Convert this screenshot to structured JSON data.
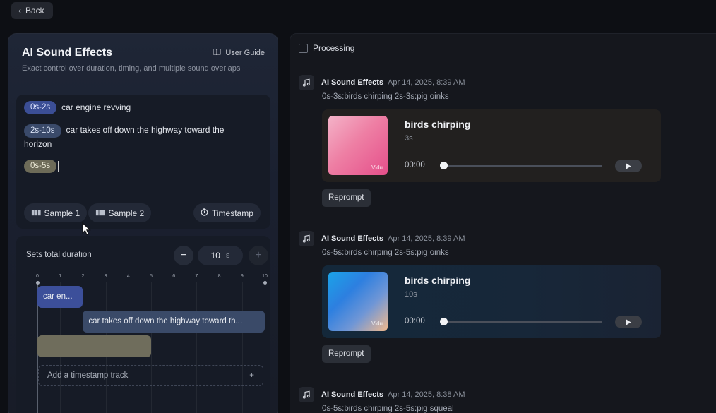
{
  "topbar": {
    "back_label": "Back"
  },
  "left": {
    "title": "AI Sound Effects",
    "guide_label": "User Guide",
    "description": "Exact control over duration, timing, and multiple sound overlaps",
    "segments": [
      {
        "range": "0s-2s",
        "text": "car engine revving"
      },
      {
        "range": "2s-10s",
        "text": "car takes off down the highway toward the horizon"
      },
      {
        "range": "0s-5s",
        "text": ""
      }
    ],
    "samples": [
      "Sample 1",
      "Sample 2"
    ],
    "timestamp_label": "Timestamp",
    "duration": {
      "label": "Sets total duration",
      "value": "10",
      "unit": "s",
      "minus": "−",
      "plus": "+"
    },
    "ticks": [
      "0",
      "1",
      "2",
      "3",
      "4",
      "5",
      "6",
      "7",
      "8",
      "9",
      "10"
    ],
    "tracks": [
      {
        "label": "car en...",
        "start": 0,
        "end": 2
      },
      {
        "label": "car takes off down the highway toward th...",
        "start": 2,
        "end": 10
      },
      {
        "label": "",
        "start": 0,
        "end": 5
      }
    ],
    "add_track_label": "Add a timestamp track",
    "add_track_plus": "+"
  },
  "right": {
    "processing_label": "Processing",
    "entries": [
      {
        "title": "AI Sound Effects",
        "date": "Apr 14, 2025, 8:39 AM",
        "prompt": "0s-3s:birds chirping  2s-3s:pig oinks",
        "name": "birds chirping",
        "duration": "3s",
        "time": "00:00",
        "progress": 0,
        "thumb_tag": "Vidu",
        "reprompt": "Reprompt"
      },
      {
        "title": "AI Sound Effects",
        "date": "Apr 14, 2025, 8:39 AM",
        "prompt": "0s-5s:birds chirping  2s-5s:pig oinks",
        "name": "birds chirping",
        "duration": "10s",
        "time": "00:00",
        "progress": 0,
        "thumb_tag": "Vidu",
        "reprompt": "Reprompt"
      },
      {
        "title": "AI Sound Effects",
        "date": "Apr 14, 2025, 8:38 AM",
        "prompt": "0s-5s:birds chirping  2s-5s:pig squeal"
      }
    ]
  }
}
